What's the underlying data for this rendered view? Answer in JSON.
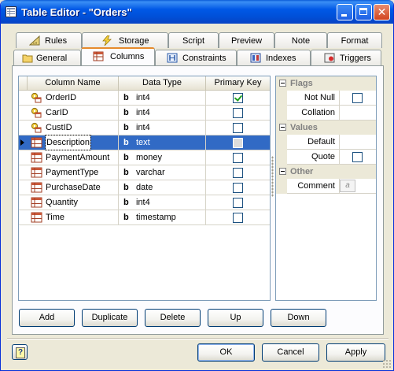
{
  "window": {
    "title": "Table Editor - \"Orders\""
  },
  "tabs_back": [
    {
      "label": "Rules",
      "icon": "ruler-icon"
    },
    {
      "label": "Storage",
      "icon": "lightning-icon"
    },
    {
      "label": "Script"
    },
    {
      "label": "Preview"
    },
    {
      "label": "Note"
    },
    {
      "label": "Format"
    }
  ],
  "tabs_front": [
    {
      "label": "General",
      "icon": "folder-icon"
    },
    {
      "label": "Columns",
      "icon": "table-icon",
      "active": true
    },
    {
      "label": "Constraints",
      "icon": "constraints-icon"
    },
    {
      "label": "Indexes",
      "icon": "index-icon"
    },
    {
      "label": "Triggers",
      "icon": "trigger-icon"
    }
  ],
  "grid": {
    "headers": [
      "Column Name",
      "Data Type",
      "Primary Key"
    ],
    "rows": [
      {
        "name": "OrderID",
        "type": "int4",
        "pk": true,
        "key": true
      },
      {
        "name": "CarID",
        "type": "int4",
        "pk": false,
        "key": true
      },
      {
        "name": "CustID",
        "type": "int4",
        "pk": false,
        "key": true
      },
      {
        "name": "Description",
        "type": "text",
        "pk": false,
        "selected": true
      },
      {
        "name": "PaymentAmount",
        "type": "money",
        "pk": false
      },
      {
        "name": "PaymentType",
        "type": "varchar",
        "pk": false
      },
      {
        "name": "PurchaseDate",
        "type": "date",
        "pk": false
      },
      {
        "name": "Quantity",
        "type": "int4",
        "pk": false
      },
      {
        "name": "Time",
        "type": "timestamp",
        "pk": false
      }
    ],
    "type_badge": "b"
  },
  "inspector": {
    "flags": {
      "label": "Flags",
      "not_null": "Not Null",
      "collation": "Collation"
    },
    "values": {
      "label": "Values",
      "default": "Default",
      "quote": "Quote"
    },
    "other": {
      "label": "Other",
      "comment": "Comment",
      "comment_editor_glyph": "a"
    }
  },
  "row_buttons": [
    "Add",
    "Duplicate",
    "Delete",
    "Up",
    "Down"
  ],
  "dialog_buttons": {
    "help": "?",
    "ok": "OK",
    "cancel": "Cancel",
    "apply": "Apply"
  }
}
